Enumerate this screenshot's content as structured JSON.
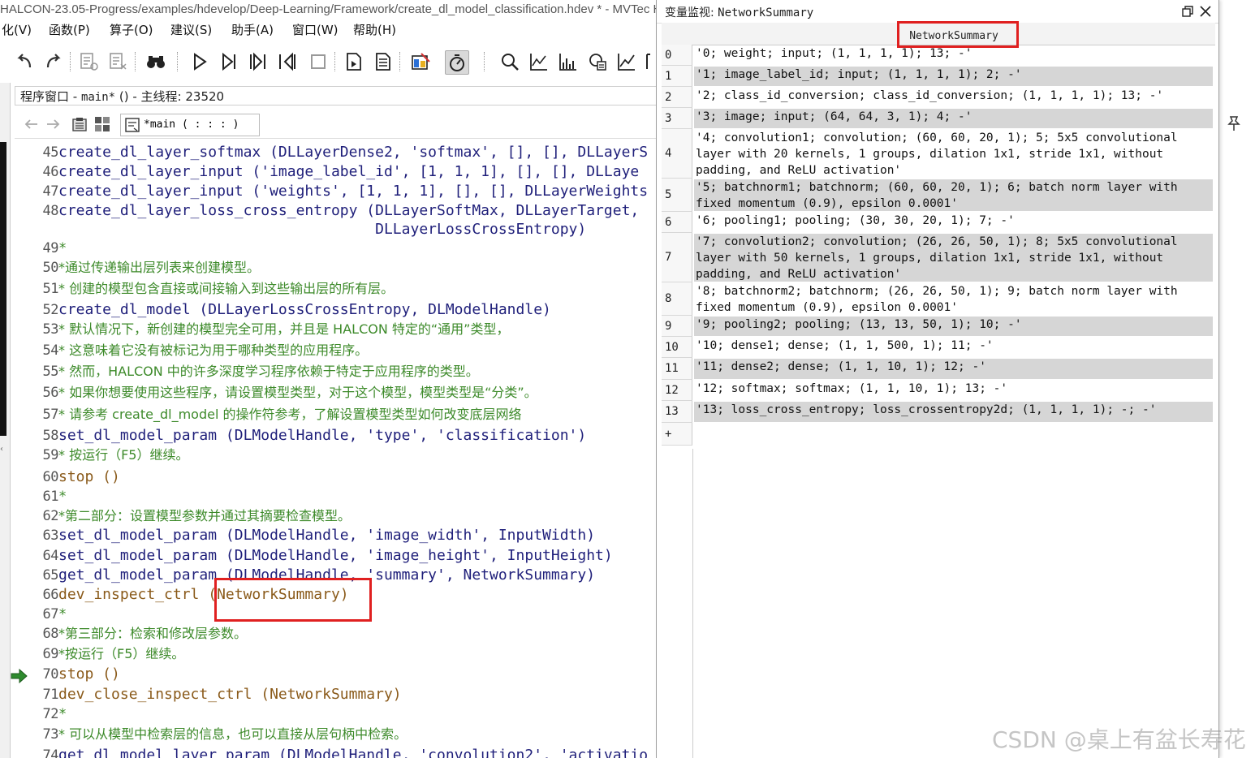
{
  "window": {
    "title": "HALCON-23.05-Progress/examples/hdevelop/Deep-Learning/Framework/create_dl_model_classification.hdev * - MVTec HA"
  },
  "menu": [
    "化(V)",
    "函数(P)",
    "算子(O)",
    "建议(S)",
    "助手(A)",
    "窗口(W)",
    "帮助(H)"
  ],
  "program_window": {
    "title_prefix": "程序窗口 - ",
    "title_proc": "main*",
    "title_suffix": " () - 主线程: 23520",
    "proc_selector": "*main ( : : : )"
  },
  "code_lines": [
    {
      "n": "45",
      "kind": "op",
      "text": "create_dl_layer_softmax (DLLayerDense2, 'softmax', [], [], DLLayerS"
    },
    {
      "n": "46",
      "kind": "op",
      "text": "create_dl_layer_input ('image_label_id', [1, 1, 1], [], [], DLLaye"
    },
    {
      "n": "47",
      "kind": "op",
      "text": "create_dl_layer_input ('weights', [1, 1, 1], [], [], DLLayerWeights"
    },
    {
      "n": "48",
      "kind": "op",
      "text": "create_dl_layer_loss_cross_entropy (DLLayerSoftMax, DLLayerTarget,"
    },
    {
      "n": "",
      "kind": "op",
      "text": "                                    DLLayerLossCrossEntropy)"
    },
    {
      "n": "49",
      "kind": "cm",
      "text": "*"
    },
    {
      "n": "50",
      "kind": "cn",
      "text": "*通过传递输出层列表来创建模型。"
    },
    {
      "n": "51",
      "kind": "cn",
      "text": "* 创建的模型包含直接或间接输入到这些输出层的所有层。"
    },
    {
      "n": "52",
      "kind": "op",
      "text": "create_dl_model (DLLayerLossCrossEntropy, DLModelHandle)"
    },
    {
      "n": "53",
      "kind": "cn",
      "text": "* 默认情况下，新创建的模型完全可用，并且是 HALCON 特定的“通用”类型，"
    },
    {
      "n": "54",
      "kind": "cn",
      "text": "* 这意味着它没有被标记为用于哪种类型的应用程序。"
    },
    {
      "n": "55",
      "kind": "cn",
      "text": "* 然而，HALCON 中的许多深度学习程序依赖于特定于应用程序的类型。"
    },
    {
      "n": "56",
      "kind": "cn",
      "text": "* 如果你想要使用这些程序，请设置模型类型，对于这个模型，模型类型是“分类”。"
    },
    {
      "n": "57",
      "kind": "cn",
      "text": "* 请参考 create_dl_model 的操作符参考，了解设置模型类型如何改变底层网络"
    },
    {
      "n": "58",
      "kind": "op",
      "text": "set_dl_model_param (DLModelHandle, 'type', 'classification')"
    },
    {
      "n": "59",
      "kind": "cn",
      "text": "* 按运行（F5）继续。"
    },
    {
      "n": "60",
      "kind": "dc",
      "text": "stop ()"
    },
    {
      "n": "61",
      "kind": "cm",
      "text": "*"
    },
    {
      "n": "62",
      "kind": "cn",
      "text": "*第二部分：设置模型参数并通过其摘要检查模型。"
    },
    {
      "n": "63",
      "kind": "op",
      "text": "set_dl_model_param (DLModelHandle, 'image_width', InputWidth)"
    },
    {
      "n": "64",
      "kind": "op",
      "text": "set_dl_model_param (DLModelHandle, 'image_height', InputHeight)"
    },
    {
      "n": "65",
      "kind": "op",
      "text": "get_dl_model_param (DLModelHandle, 'summary', NetworkSummary)"
    },
    {
      "n": "66",
      "kind": "dc",
      "text": "dev_inspect_ctrl (NetworkSummary)"
    },
    {
      "n": "67",
      "kind": "cm",
      "text": "*"
    },
    {
      "n": "68",
      "kind": "cn",
      "text": "*第三部分：检索和修改层参数。"
    },
    {
      "n": "69",
      "kind": "cn",
      "text": "*按运行（F5）继续。"
    },
    {
      "n": "70",
      "kind": "dc",
      "text": "stop ()"
    },
    {
      "n": "71",
      "kind": "dc",
      "text": "dev_close_inspect_ctrl (NetworkSummary)"
    },
    {
      "n": "72",
      "kind": "cm",
      "text": "*"
    },
    {
      "n": "73",
      "kind": "cn",
      "text": "* 可以从模型中检索层的信息，也可以直接从层句柄中检索。"
    },
    {
      "n": "74",
      "kind": "op",
      "text": "get_dl_model_layer_param (DLModelHandle, 'convolution2', 'activatio"
    }
  ],
  "variable_monitor": {
    "title_prefix": "变量监视: ",
    "title_var": "NetworkSummary",
    "column_header": "NetworkSummary",
    "rows": [
      {
        "idx": "0",
        "value": "'0; weight; input; (1, 1, 1, 1); 13; -'"
      },
      {
        "idx": "1",
        "value": "'1; image_label_id; input; (1, 1, 1, 1); 2; -'"
      },
      {
        "idx": "2",
        "value": "'2; class_id_conversion; class_id_conversion; (1, 1, 1, 1); 13; -'"
      },
      {
        "idx": "3",
        "value": "'3; image; input; (64, 64, 3, 1); 4; -'"
      },
      {
        "idx": "4",
        "value": "'4; convolution1; convolution; (60, 60, 20, 1); 5; 5x5 convolutional layer with 20 kernels, 1 groups, dilation 1x1, stride 1x1, without padding, and ReLU activation'"
      },
      {
        "idx": "5",
        "value": "'5; batchnorm1; batchnorm; (60, 60, 20, 1); 6; batch norm layer with fixed momentum (0.9), epsilon 0.0001'"
      },
      {
        "idx": "6",
        "value": "'6; pooling1; pooling; (30, 30, 20, 1); 7; -'"
      },
      {
        "idx": "7",
        "value": "'7; convolution2; convolution; (26, 26, 50, 1); 8; 5x5 convolutional layer with 50 kernels, 1 groups, dilation 1x1, stride 1x1, without padding, and ReLU activation'"
      },
      {
        "idx": "8",
        "value": "'8; batchnorm2; batchnorm; (26, 26, 50, 1); 9; batch norm layer with fixed momentum (0.9), epsilon 0.0001'"
      },
      {
        "idx": "9",
        "value": "'9; pooling2; pooling; (13, 13, 50, 1); 10; -'"
      },
      {
        "idx": "10",
        "value": "'10; dense1; dense; (1, 1, 500, 1); 11; -'"
      },
      {
        "idx": "11",
        "value": "'11; dense2; dense; (1, 1, 10, 1); 12; -'"
      },
      {
        "idx": "12",
        "value": "'12; softmax; softmax; (1, 1, 10, 1); 13; -'"
      },
      {
        "idx": "13",
        "value": "'13; loss_cross_entropy; loss_crossentropy2d; (1, 1, 1, 1); -; -'"
      }
    ],
    "add_row": "+"
  },
  "watermark": "CSDN @桌上有盆长寿花",
  "colors": {
    "highlight_box": "#e02020",
    "comment": "#3d8a2a",
    "operator": "#1a1a6e",
    "control": "#8a5a1a"
  }
}
